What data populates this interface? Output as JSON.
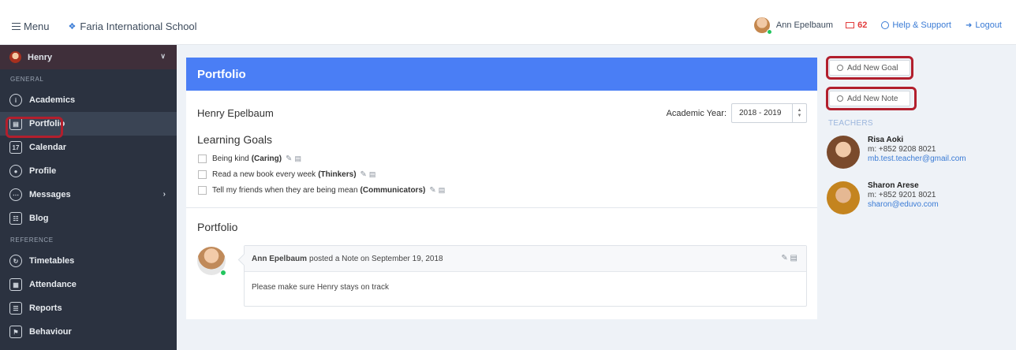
{
  "topbar": {
    "menu_label": "Menu",
    "school_name": "Faria International School",
    "user_name": "Ann Epelbaum",
    "message_count": "62",
    "help_label": "Help & Support",
    "logout_label": "Logout"
  },
  "sidebar": {
    "student": "Henry",
    "section_general": "GENERAL",
    "section_reference": "REFERENCE",
    "general_items": [
      {
        "label": "Academics"
      },
      {
        "label": "Portfolio"
      },
      {
        "label": "Calendar"
      },
      {
        "label": "Profile"
      },
      {
        "label": "Messages"
      },
      {
        "label": "Blog"
      }
    ],
    "reference_items": [
      {
        "label": "Timetables"
      },
      {
        "label": "Attendance"
      },
      {
        "label": "Reports"
      },
      {
        "label": "Behaviour"
      }
    ],
    "active_item": "Portfolio"
  },
  "main": {
    "header_title": "Portfolio",
    "student_name": "Henry Epelbaum",
    "academic_year_label": "Academic Year:",
    "academic_year_value": "2018 - 2019",
    "learning_goals_title": "Learning Goals",
    "goals": [
      {
        "text": "Being kind",
        "trait": "(Caring)"
      },
      {
        "text": "Read a new book every week",
        "trait": "(Thinkers)"
      },
      {
        "text": "Tell my friends when they are being mean",
        "trait": "(Communicators)"
      }
    ],
    "portfolio_title": "Portfolio",
    "note": {
      "author": "Ann Epelbaum",
      "meta": "posted a Note on September 19, 2018",
      "body": "Please make sure Henry stays on track"
    }
  },
  "right": {
    "add_goal_label": "Add New Goal",
    "add_note_label": "Add New Note",
    "teachers_label": "TEACHERS",
    "teachers": [
      {
        "name": "Risa Aoki",
        "phone": "m: +852 9208 8021",
        "email": "mb.test.teacher@gmail.com"
      },
      {
        "name": "Sharon Arese",
        "phone": "m: +852 9201 8021",
        "email": "sharon@eduvo.com"
      }
    ]
  },
  "colors": {
    "accent": "#4a7ef5",
    "sidebar_bg": "#2b3240",
    "highlight_outline": "#b21f2d",
    "link": "#3a7bd5",
    "online": "#22c55e"
  }
}
